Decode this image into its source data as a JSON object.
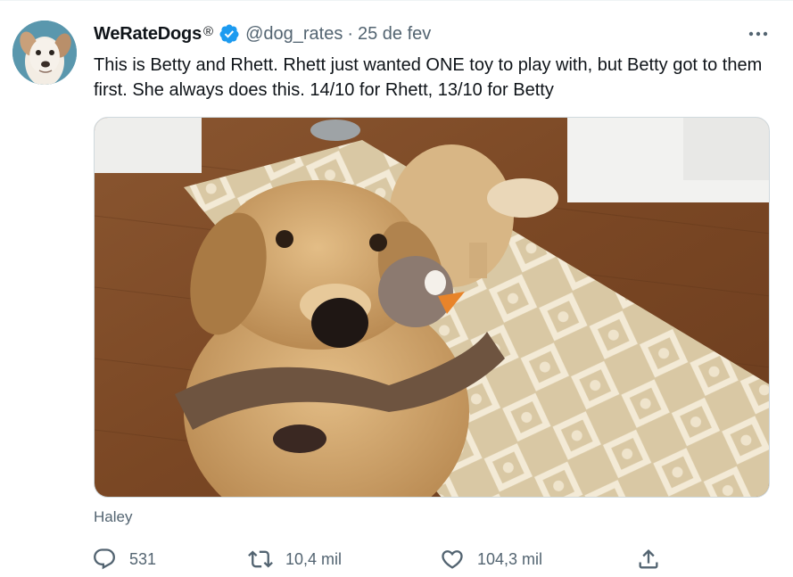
{
  "tweet": {
    "display_name": "WeRateDogs",
    "registered_mark": "®",
    "handle": "@dog_rates",
    "separator": "·",
    "date": "25 de fev",
    "text": "This is Betty and Rhett. Rhett just wanted ONE toy to play with, but Betty got to them first. She always does this. 14/10 for Rhett, 13/10 for Betty",
    "media_caption": "Haley"
  },
  "actions": {
    "reply_count": "531",
    "retweet_count": "10,4 mil",
    "like_count": "104,3 mil"
  },
  "icons": {
    "verified": "verified-badge-icon",
    "more": "more-options-icon",
    "reply": "reply-icon",
    "retweet": "retweet-icon",
    "like": "heart-icon",
    "share": "share-icon"
  },
  "colors": {
    "verified_blue": "#1d9bf0",
    "text_primary": "#0f1419",
    "text_secondary": "#536471"
  }
}
